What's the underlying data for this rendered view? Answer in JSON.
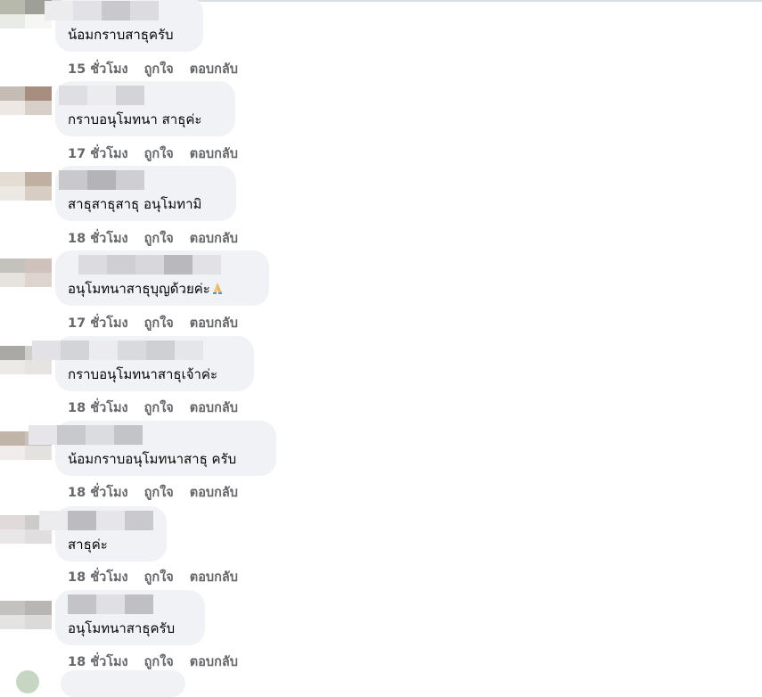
{
  "actions": {
    "like": "ถูกใจ",
    "reply": "ตอบกลับ"
  },
  "comments": [
    {
      "text": "น้อมกราบสาธุครับ",
      "time": "15 ชั่วโมง"
    },
    {
      "text": "กราบอนุโมทนา สาธุค่ะ",
      "time": "17 ชั่วโมง"
    },
    {
      "text": "สาธุสาธุสาธุ อนุโมทามิ",
      "time": "18 ชั่วโมง"
    },
    {
      "text": "อนุโมทนาสาธุบุญด้วยค่ะ",
      "emoji": "folded-hands-icon",
      "time": "17 ชั่วโมง"
    },
    {
      "text": "กราบอนุโมทนาสาธุเจ้าค่ะ",
      "time": "18 ชั่วโมง"
    },
    {
      "text": "น้อมกราบอนุโมทนาสาธุ ครับ",
      "time": "18 ชั่วโมง"
    },
    {
      "text": "สาธุค่ะ",
      "time": "18 ชั่วโมง"
    },
    {
      "text": "อนุโมทนาสาธุครับ",
      "time": "18 ชั่วโมง"
    }
  ],
  "colors": {
    "bubble": "#f0f2f5",
    "meta_text": "#65676b",
    "body_text": "#050505"
  }
}
